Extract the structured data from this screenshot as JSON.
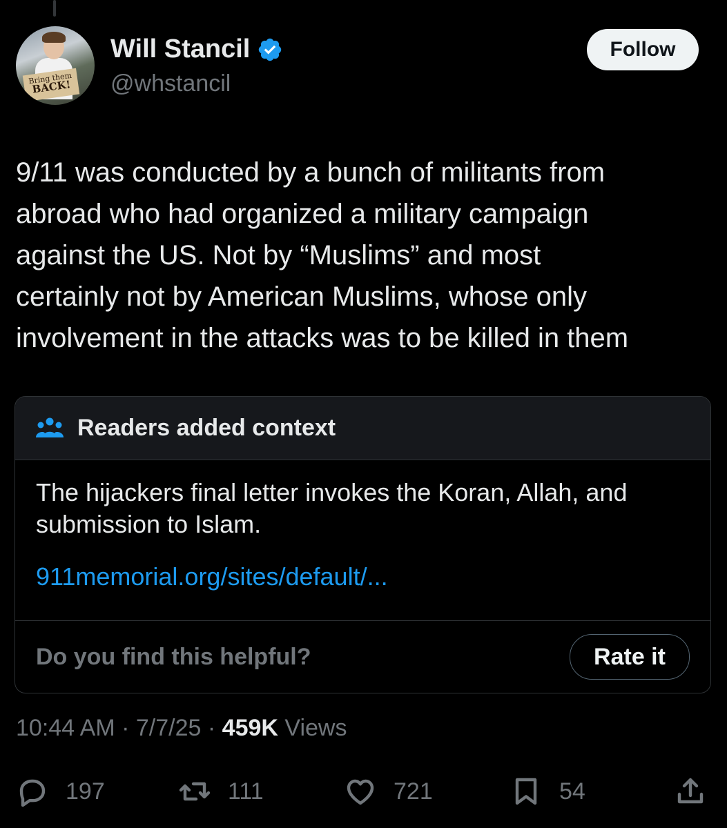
{
  "author": {
    "name": "Will Stancil",
    "handle": "@whstancil",
    "avatar_sign_line1": "Bring them",
    "avatar_sign_line2": "BACK!"
  },
  "follow_label": "Follow",
  "tweet": {
    "text": "9/11 was conducted by a bunch of militants from\nabroad who had organized a military campaign\nagainst the US. Not by “Muslims” and most\ncertainly not by American Muslims, whose only\ninvolvement in the attacks was to be killed in them"
  },
  "community_note": {
    "title": "Readers added context",
    "text": "The hijackers final letter invokes the Koran, Allah, and submission to Islam.",
    "link": "911memorial.org/sites/default/...",
    "helpful_question": "Do you find this helpful?",
    "rate_label": "Rate it"
  },
  "meta": {
    "time": "10:44 AM",
    "date": "7/7/25",
    "views_count": "459K",
    "views_label": "Views",
    "separator": "·"
  },
  "actions": {
    "replies": "197",
    "reposts": "111",
    "likes": "721",
    "bookmarks": "54"
  },
  "colors": {
    "background": "#000000",
    "text": "#e7e9ea",
    "secondary": "#71767b",
    "link": "#1d9bf0",
    "verified": "#1d9bf0"
  }
}
